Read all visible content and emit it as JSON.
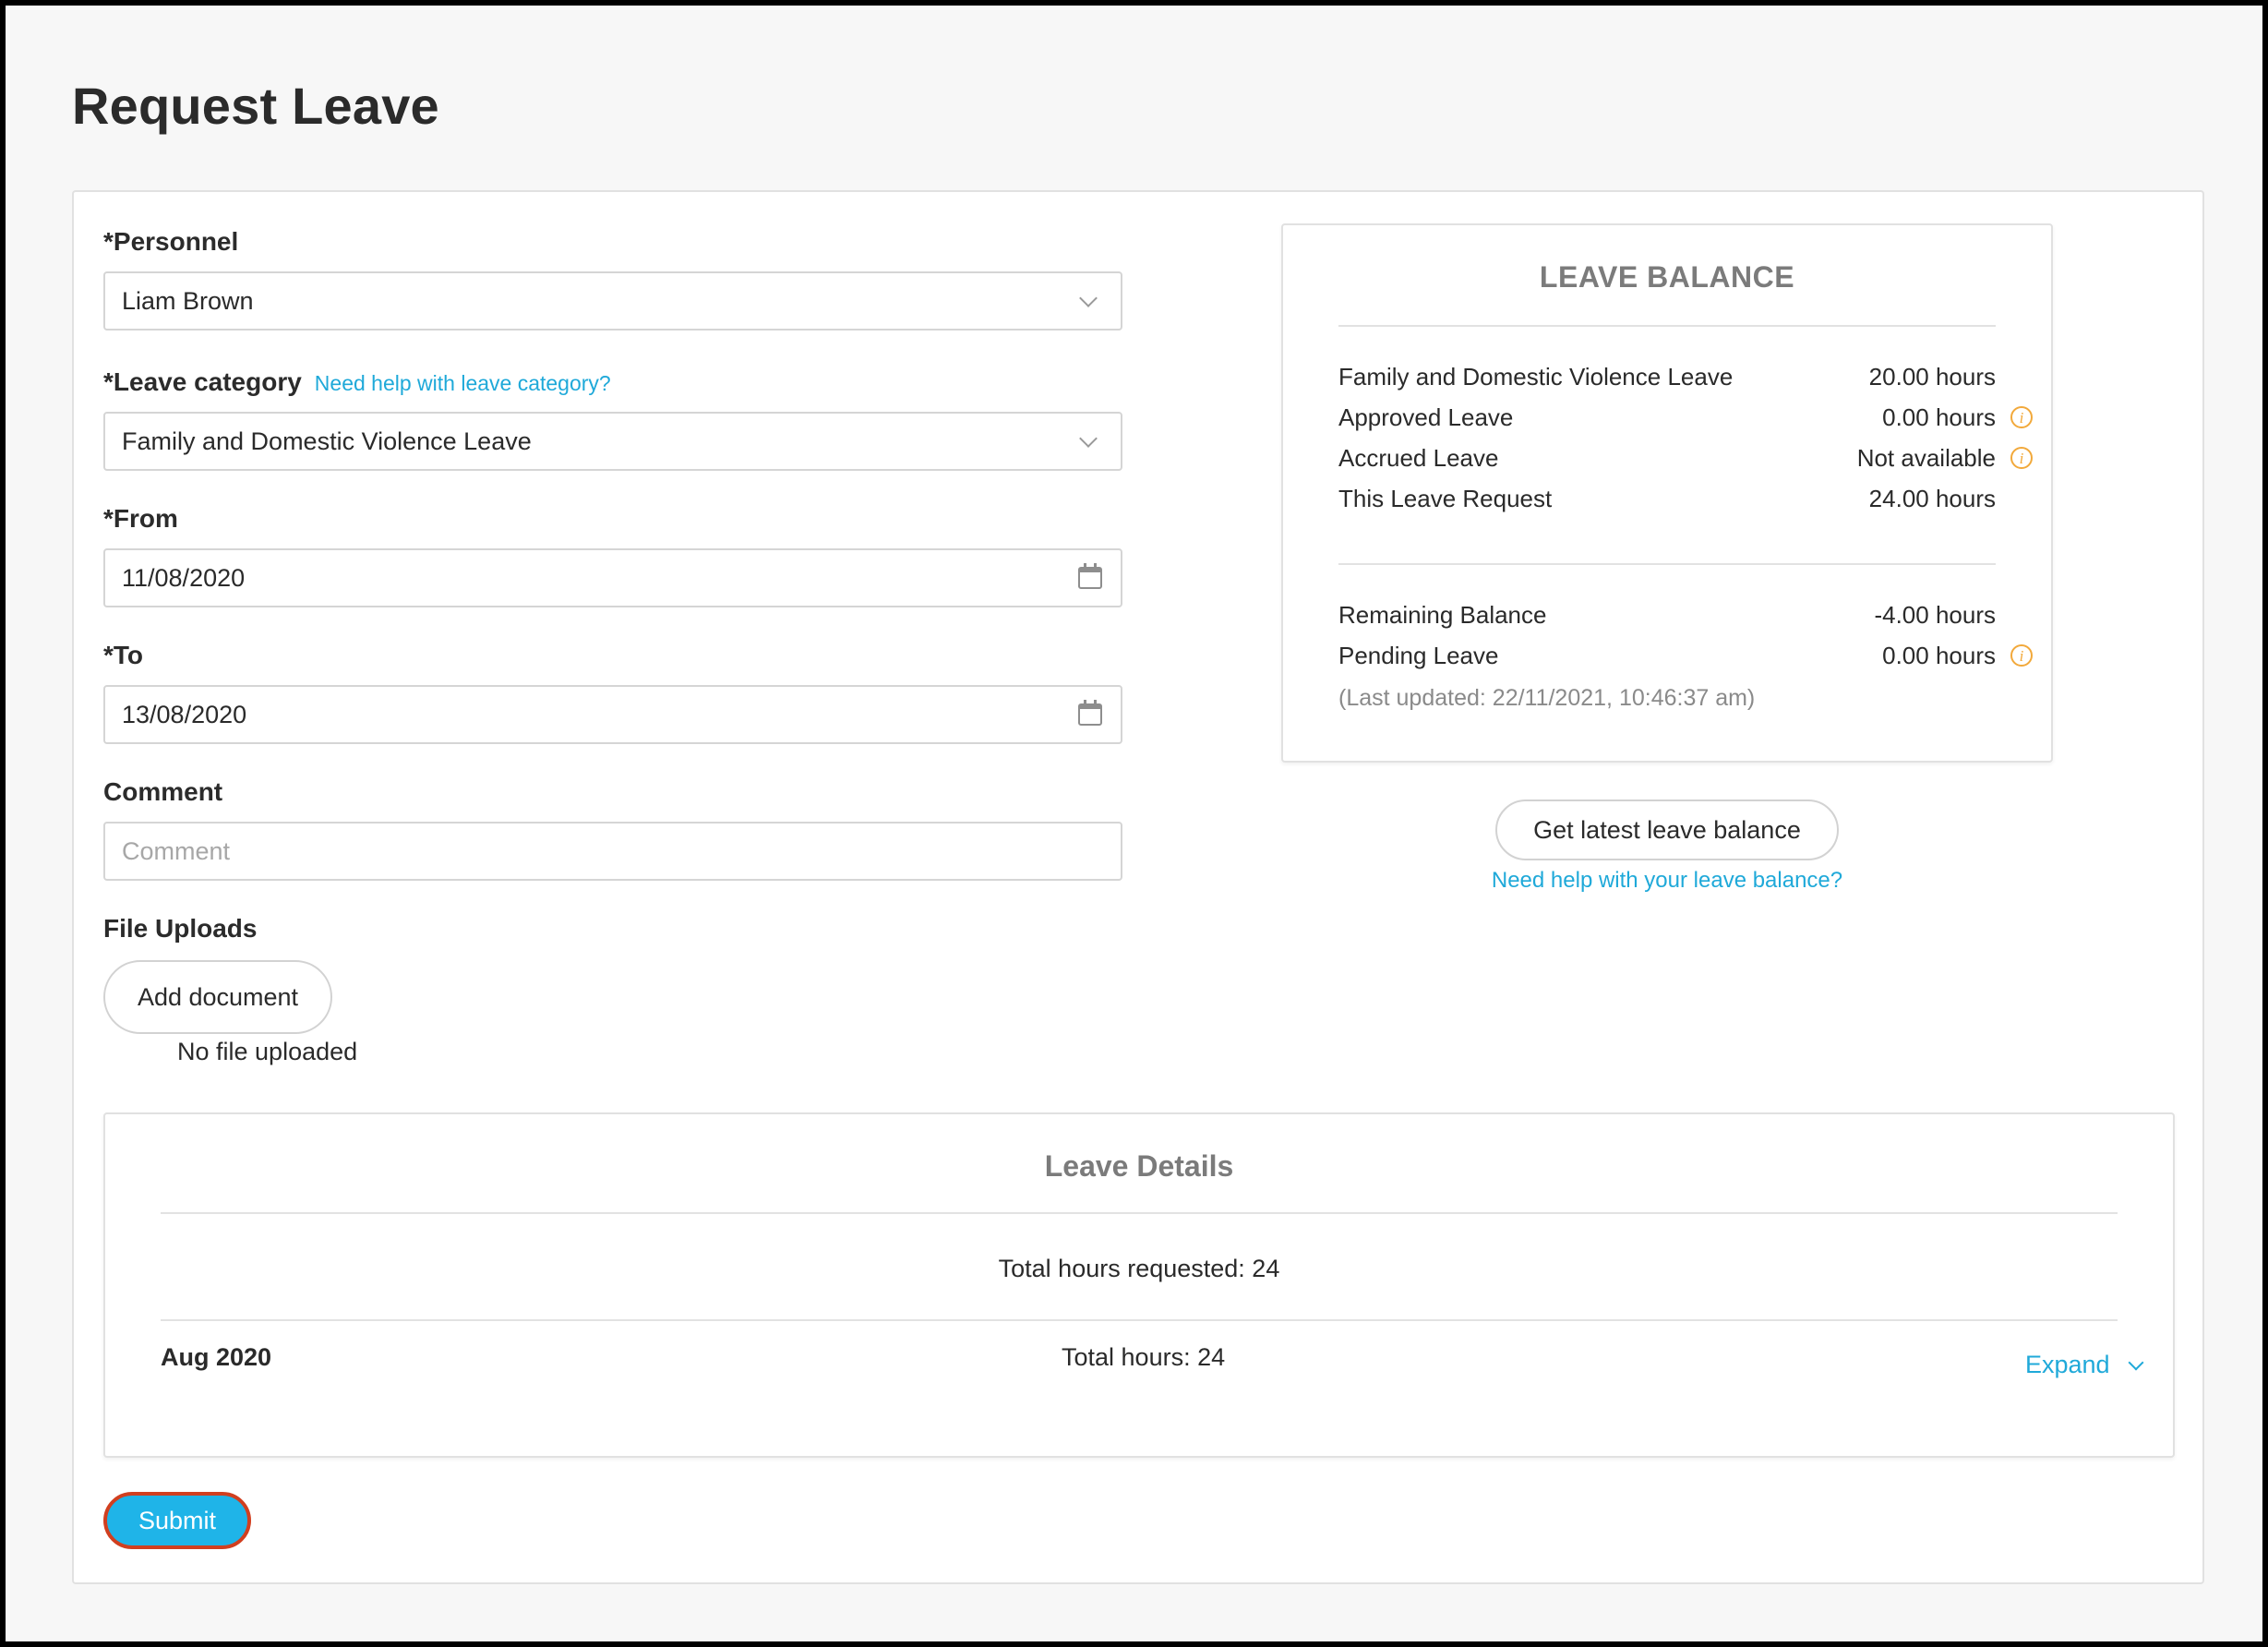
{
  "page": {
    "title": "Request Leave"
  },
  "form": {
    "personnel": {
      "label": "*Personnel",
      "value": "Liam Brown"
    },
    "leave_category": {
      "label": "*Leave category",
      "help": "Need help with leave category?",
      "value": "Family and Domestic Violence Leave"
    },
    "from": {
      "label": "*From",
      "value": "11/08/2020"
    },
    "to": {
      "label": "*To",
      "value": "13/08/2020"
    },
    "comment": {
      "label": "Comment",
      "placeholder": "Comment"
    },
    "file_uploads": {
      "label": "File Uploads",
      "button": "Add document",
      "status": "No file uploaded"
    }
  },
  "leave_balance": {
    "title": "LEAVE BALANCE",
    "rows": [
      {
        "label": "Family and Domestic Violence Leave",
        "value": "20.00 hours"
      },
      {
        "label": "Approved Leave",
        "value": "0.00 hours"
      },
      {
        "label": "Accrued Leave",
        "value": "Not available"
      },
      {
        "label": "This Leave Request",
        "value": "24.00 hours"
      }
    ],
    "summary": [
      {
        "label": "Remaining Balance",
        "value": "-4.00 hours"
      },
      {
        "label": "Pending Leave",
        "value": "0.00 hours"
      }
    ],
    "last_updated": "(Last updated: 22/11/2021, 10:46:37 am)",
    "refresh_button": "Get latest leave balance",
    "help_link": "Need help with your leave balance?"
  },
  "leave_details": {
    "title": "Leave Details",
    "total_requested": "Total hours requested: 24",
    "months": [
      {
        "month": "Aug 2020",
        "total": "Total hours: 24",
        "expand": "Expand"
      }
    ]
  },
  "actions": {
    "submit": "Submit"
  },
  "colors": {
    "accent": "#1fb4e8",
    "link": "#1fa9d9",
    "info": "#f2a93b",
    "submit_border": "#d13f1f"
  },
  "icons": [
    "chevron-down-icon",
    "calendar-icon",
    "info-icon"
  ]
}
